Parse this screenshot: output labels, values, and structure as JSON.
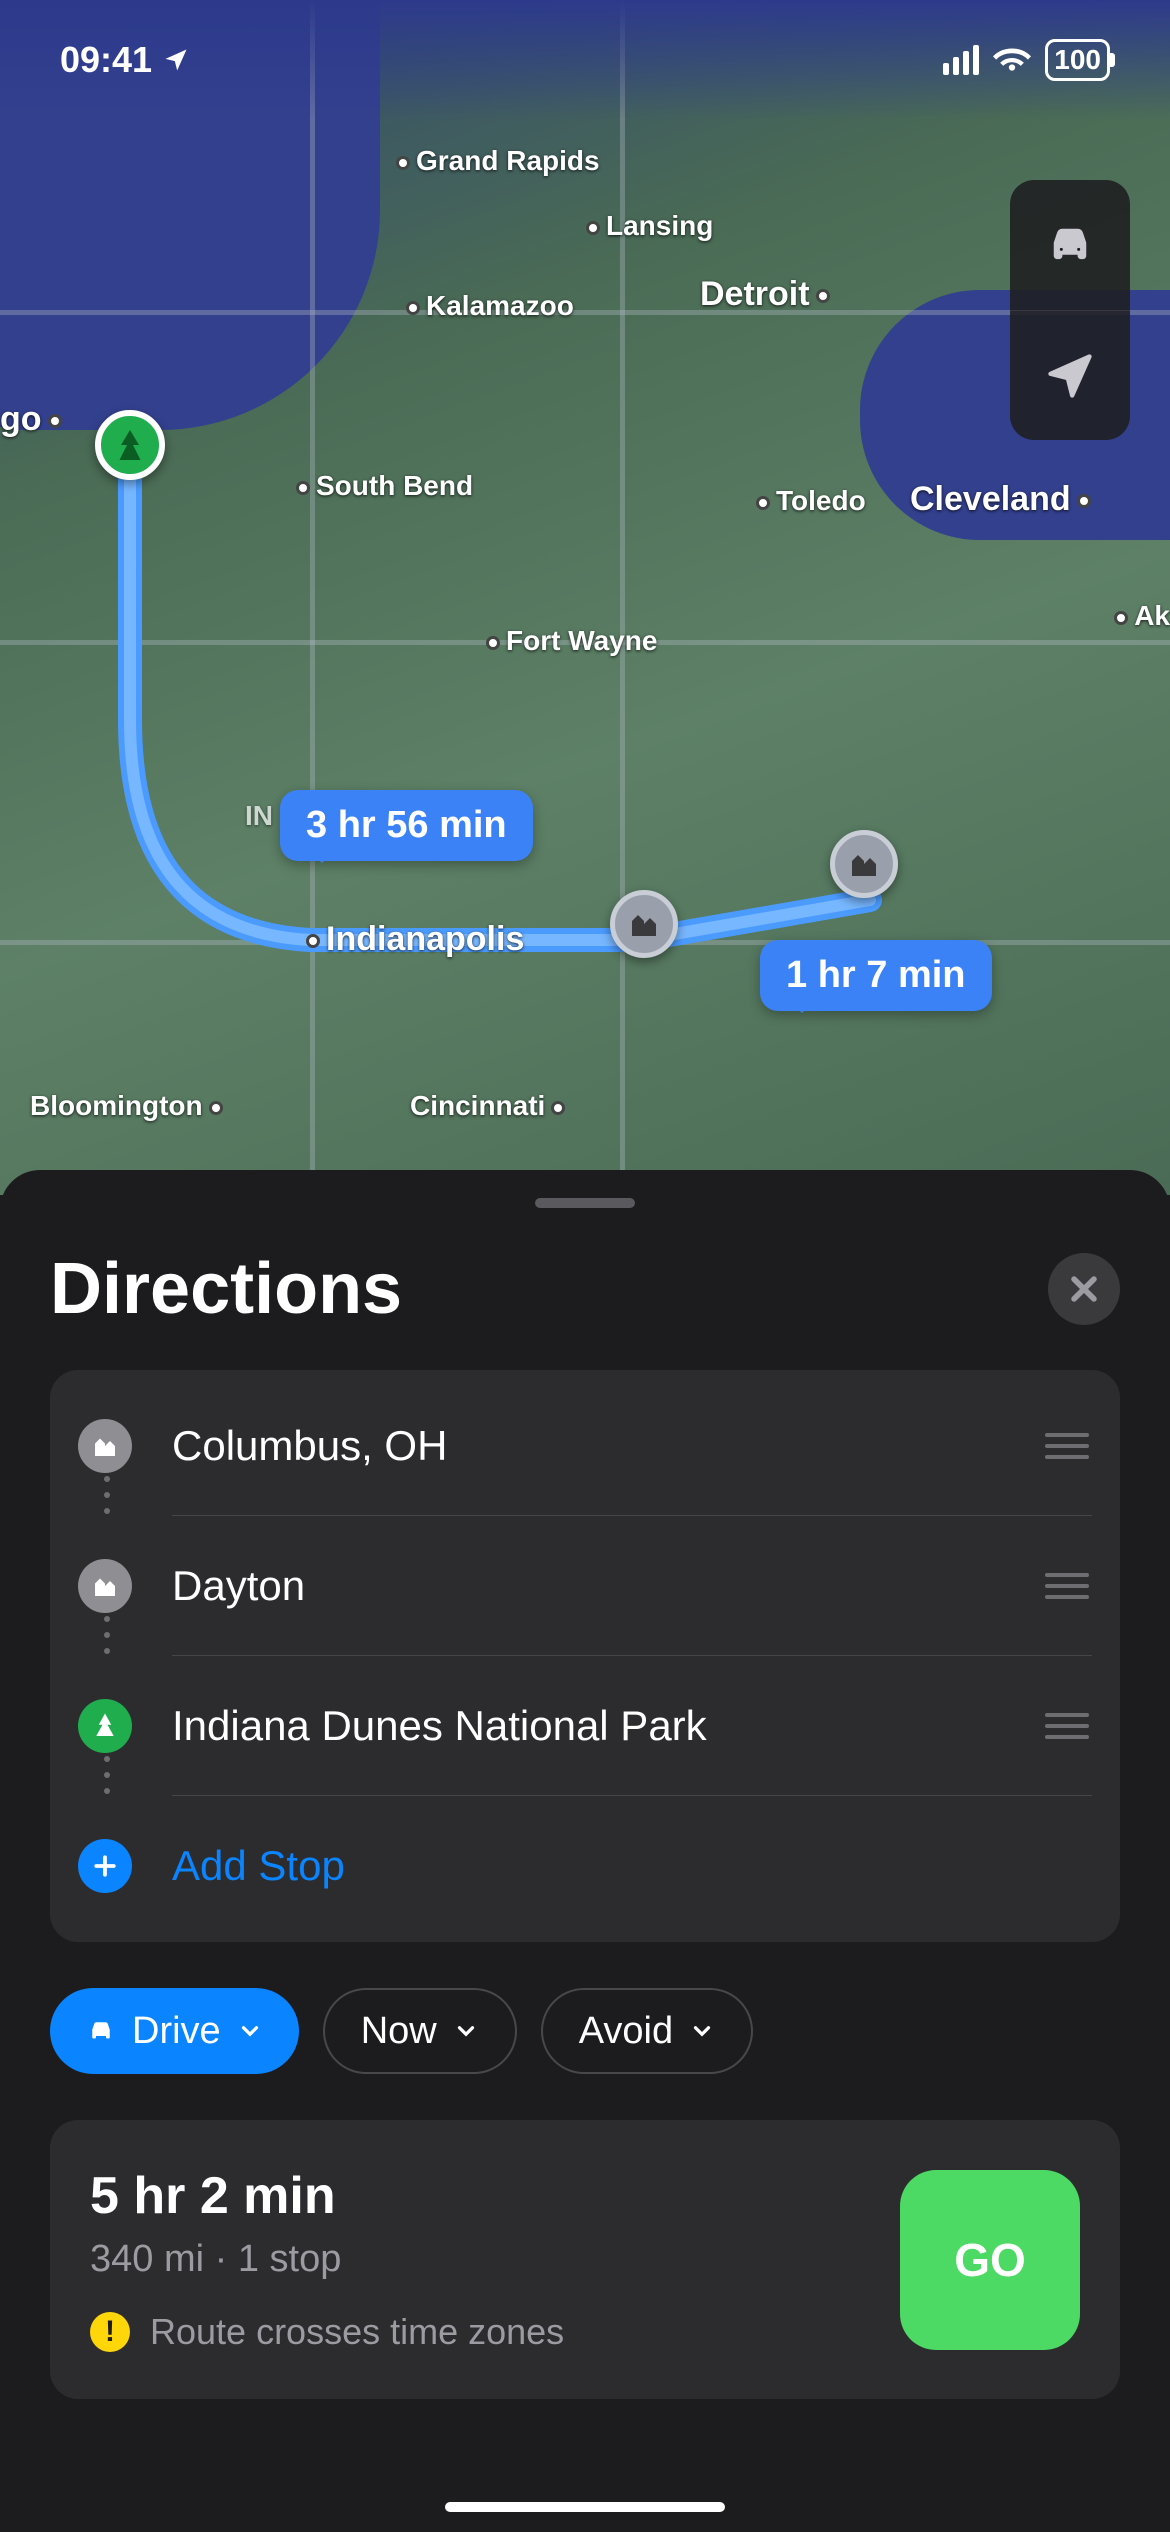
{
  "status": {
    "time": "09:41",
    "battery": "100"
  },
  "map": {
    "route_bubble_1": "3 hr 56 min",
    "route_bubble_2": "1 hr 7 min",
    "cities": {
      "grand_rapids": "Grand Rapids",
      "lansing": "Lansing",
      "kalamazoo": "Kalamazoo",
      "detroit": "Detroit",
      "south_bend": "South Bend",
      "toledo": "Toledo",
      "cleveland": "Cleveland",
      "fort_wayne": "Fort Wayne",
      "indianapolis": "Indianapolis",
      "bloomington": "Bloomington",
      "cincinnati": "Cincinnati",
      "chicago_edge": "go",
      "ak_edge": "Ak",
      "in_edge": "IN"
    }
  },
  "sheet": {
    "title": "Directions",
    "stops": [
      {
        "label": "Columbus, OH",
        "type": "city"
      },
      {
        "label": "Dayton",
        "type": "city"
      },
      {
        "label": "Indiana Dunes National Park",
        "type": "park"
      }
    ],
    "add_stop": "Add Stop",
    "chips": {
      "mode": "Drive",
      "time": "Now",
      "avoid": "Avoid"
    },
    "route": {
      "duration": "5 hr 2 min",
      "distance_sub": "340 mi · 1 stop",
      "warning": "Route crosses time zones",
      "go": "GO"
    }
  }
}
